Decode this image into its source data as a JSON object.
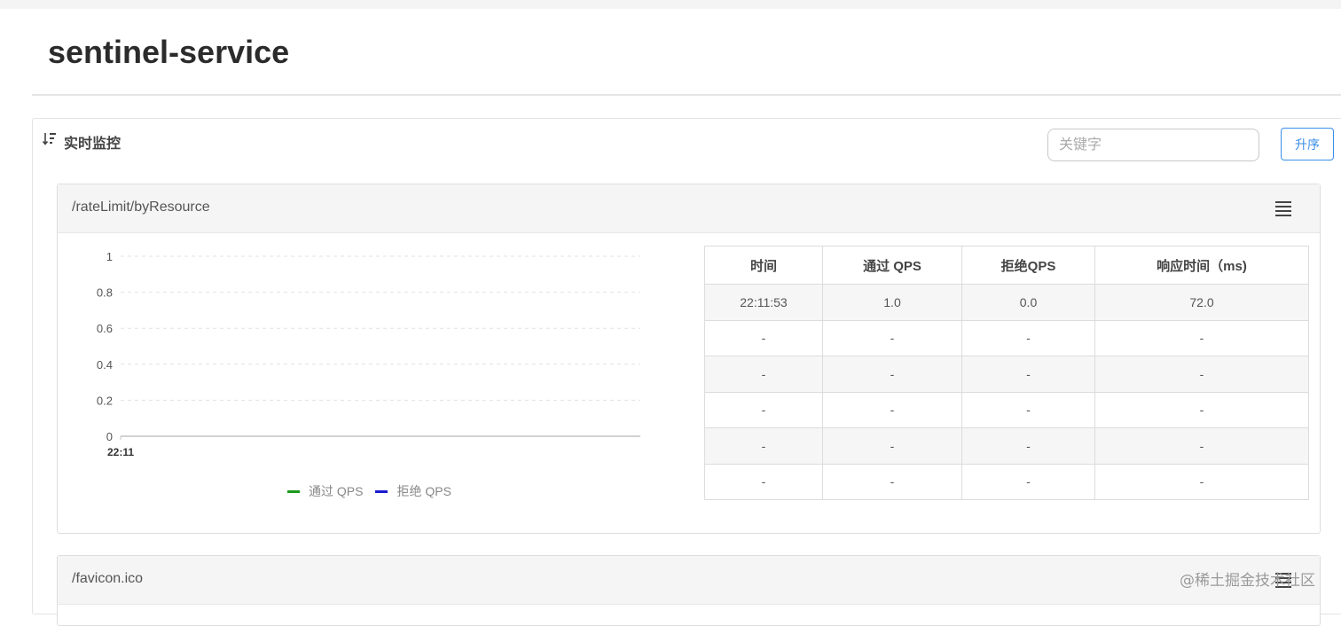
{
  "header": {
    "title": "sentinel-service"
  },
  "section": {
    "title": "实时监控",
    "icon": "sort-desc-icon"
  },
  "search": {
    "placeholder": "关键字",
    "value": ""
  },
  "sort_button": {
    "label": "升序"
  },
  "resources": [
    {
      "name": "/rateLimit/byResource",
      "menu_icon": "menu-icon",
      "chart": {
        "legend": [
          {
            "label": "通过 QPS",
            "color": "#1a9a1a"
          },
          {
            "label": "拒绝 QPS",
            "color": "#1a1ad0"
          }
        ]
      },
      "table": {
        "headers": [
          "时间",
          "通过 QPS",
          "拒绝QPS",
          "响应时间（ms)"
        ],
        "rows": [
          [
            "22:11:53",
            "1.0",
            "0.0",
            "72.0"
          ],
          [
            "-",
            "-",
            "-",
            "-"
          ],
          [
            "-",
            "-",
            "-",
            "-"
          ],
          [
            "-",
            "-",
            "-",
            "-"
          ],
          [
            "-",
            "-",
            "-",
            "-"
          ],
          [
            "-",
            "-",
            "-",
            "-"
          ]
        ]
      }
    },
    {
      "name": "/favicon.ico",
      "menu_icon": "menu-icon"
    }
  ],
  "chart_data": {
    "type": "line",
    "x": [
      "22:11"
    ],
    "series": [
      {
        "name": "通过 QPS",
        "values": [],
        "color": "#1a9a1a"
      },
      {
        "name": "拒绝 QPS",
        "values": [],
        "color": "#1a1ad0"
      }
    ],
    "ylim": [
      0,
      1
    ],
    "yticks": [
      "1",
      "0.8",
      "0.6",
      "0.4",
      "0.2",
      "0"
    ],
    "xticks": [
      "22:11"
    ],
    "grid": true,
    "legend": "bottom"
  },
  "watermark": "@稀土掘金技术社区"
}
